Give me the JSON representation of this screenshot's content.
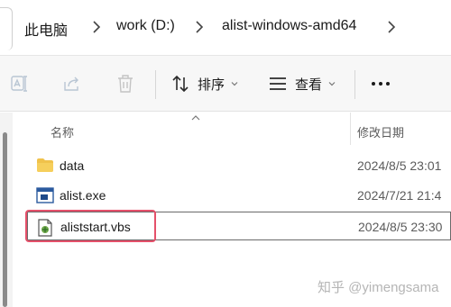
{
  "breadcrumb": {
    "items": [
      "此电脑",
      "work (D:)",
      "alist-windows-amd64"
    ]
  },
  "toolbar": {
    "sort_label": "排序",
    "view_label": "查看",
    "more_label": "···"
  },
  "columns": {
    "name": "名称",
    "modified": "修改日期"
  },
  "files": [
    {
      "name": "data",
      "modified": "2024/8/5 23:01",
      "type": "folder-icon"
    },
    {
      "name": "alist.exe",
      "modified": "2024/7/21 21:4",
      "type": "exe-icon"
    },
    {
      "name": "aliststart.vbs",
      "modified": "2024/8/5 23:30",
      "type": "vbs-script-icon",
      "selected": true
    }
  ],
  "watermark": "知乎 @yimengsama",
  "colors": {
    "highlight": "#e5506a",
    "folder": "#f0c24b",
    "toolbar_bg": "#f7f7f7"
  }
}
